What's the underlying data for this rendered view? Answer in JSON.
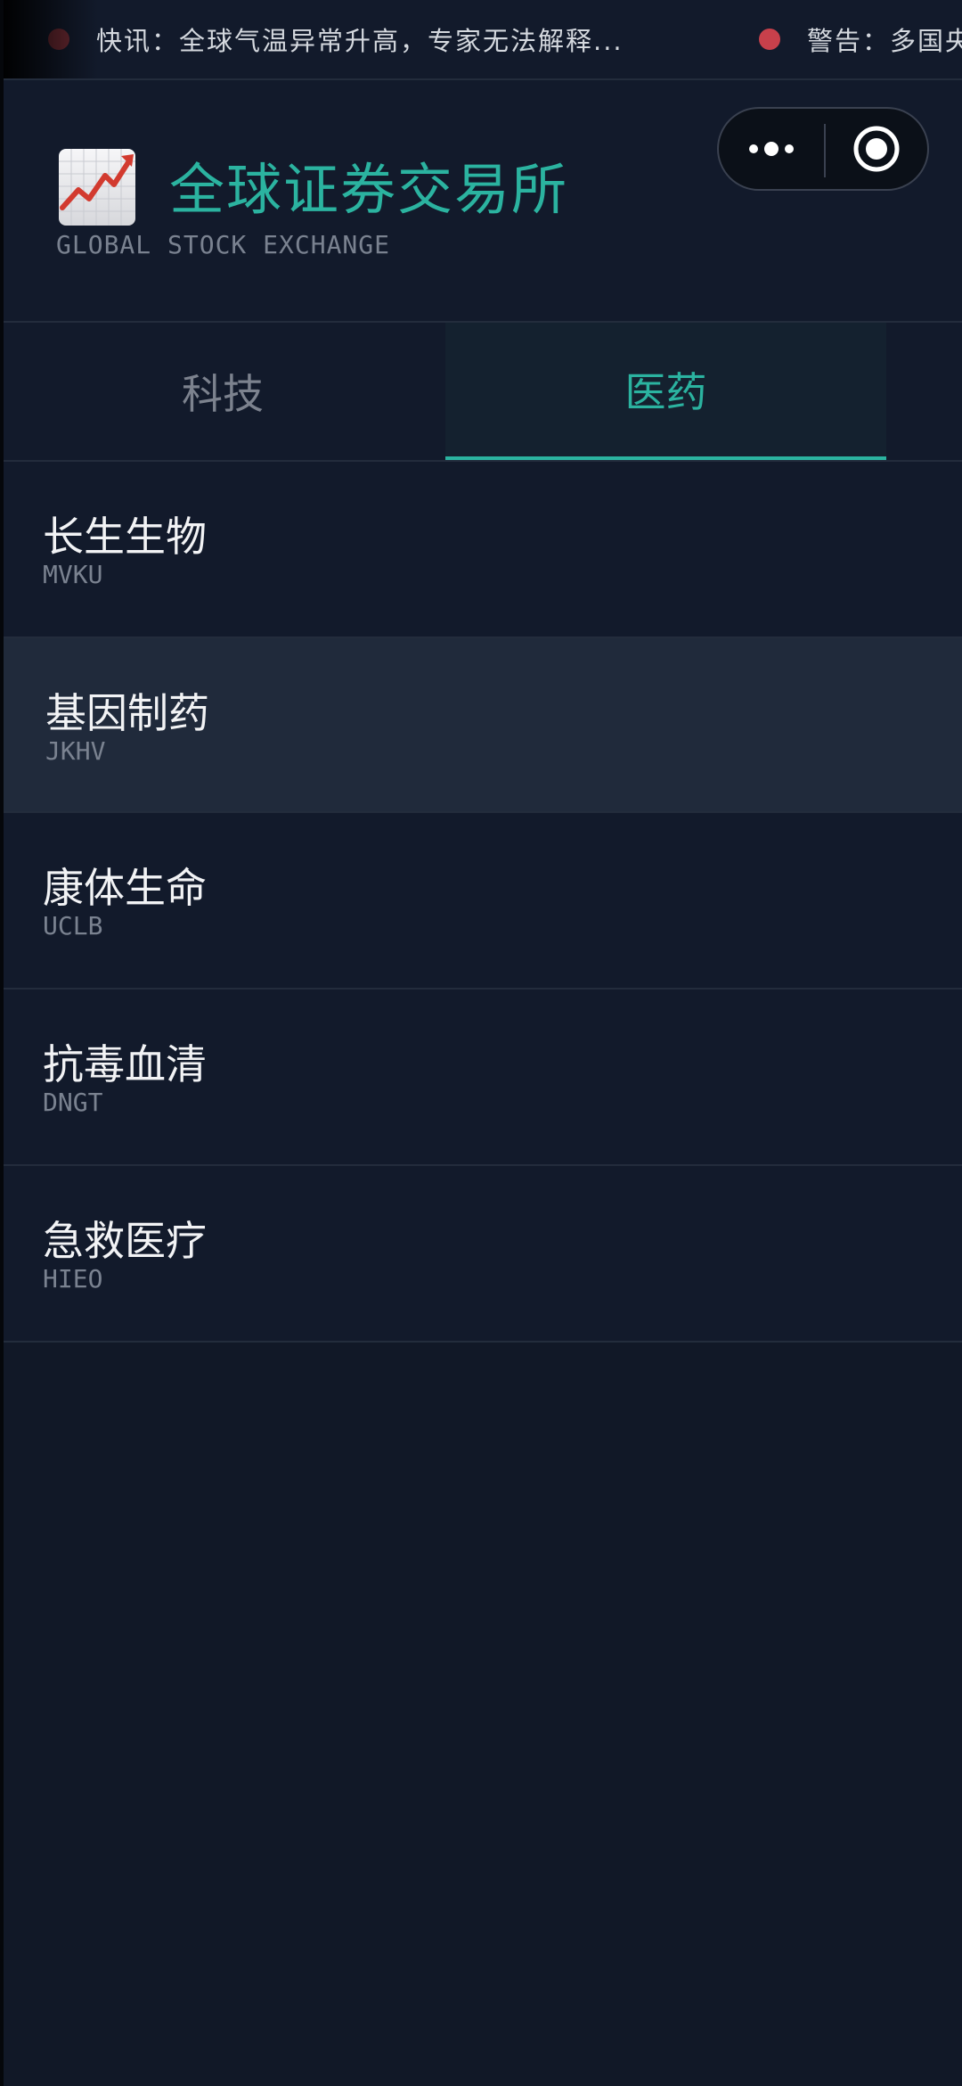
{
  "ticker": {
    "items": [
      {
        "text": "快讯：全球气温异常升高，专家无法解释..."
      },
      {
        "text": "警告：多国央"
      }
    ]
  },
  "header": {
    "title": "全球证券交易所",
    "subtitle": "GLOBAL STOCK EXCHANGE",
    "logo_icon": "chart-increasing-icon"
  },
  "capsule": {
    "more_icon": "more-dots-icon",
    "close_icon": "target-circle-icon"
  },
  "tabs": [
    {
      "label": "科技",
      "active": false
    },
    {
      "label": "医药",
      "active": true
    }
  ],
  "stocks": [
    {
      "name": "长生生物",
      "code": "MVKU",
      "selected": false
    },
    {
      "name": "基因制药",
      "code": "JKHV",
      "selected": true
    },
    {
      "name": "康体生命",
      "code": "UCLB",
      "selected": false
    },
    {
      "name": "抗毒血清",
      "code": "DNGT",
      "selected": false
    },
    {
      "name": "急救医疗",
      "code": "HIEO",
      "selected": false
    }
  ],
  "colors": {
    "accent": "#2bb3a0",
    "background": "#121a2b",
    "selected_row": "#202a3b",
    "alert_dot": "#c8404b"
  }
}
